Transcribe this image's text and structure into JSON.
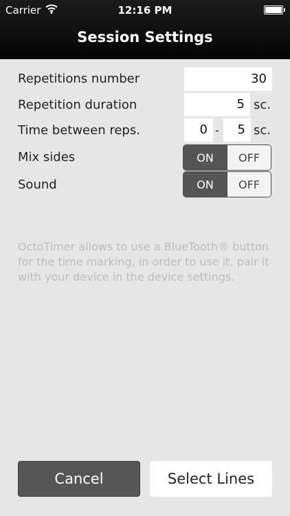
{
  "status_bar": {
    "carrier": "Carrier",
    "time": "12:16 PM"
  },
  "nav": {
    "title": "Session Settings"
  },
  "settings": {
    "repetitions": {
      "label": "Repetitions number",
      "value": "30"
    },
    "duration": {
      "label": "Repetition duration",
      "value": "5",
      "unit": "sc."
    },
    "time_between": {
      "label": "Time between reps.",
      "from": "0",
      "separator": "-",
      "to": "5",
      "unit": "sc."
    },
    "mix_sides": {
      "label": "Mix sides",
      "on_label": "ON",
      "off_label": "OFF",
      "selected": "ON"
    },
    "sound": {
      "label": "Sound",
      "on_label": "ON",
      "off_label": "OFF",
      "selected": "ON"
    }
  },
  "info_text": "OctoTimer allows to use a BlueTooth® button for the time marking, in order to use it, pair it with your device in the device settings.",
  "buttons": {
    "cancel": "Cancel",
    "select_lines": "Select Lines"
  },
  "colors": {
    "bar": "#0d0d0d",
    "background": "#e6e6e6",
    "toggle_selected": "#555555",
    "info_text": "#bdbdbd"
  },
  "icons": [
    "wifi-icon",
    "battery-icon"
  ]
}
